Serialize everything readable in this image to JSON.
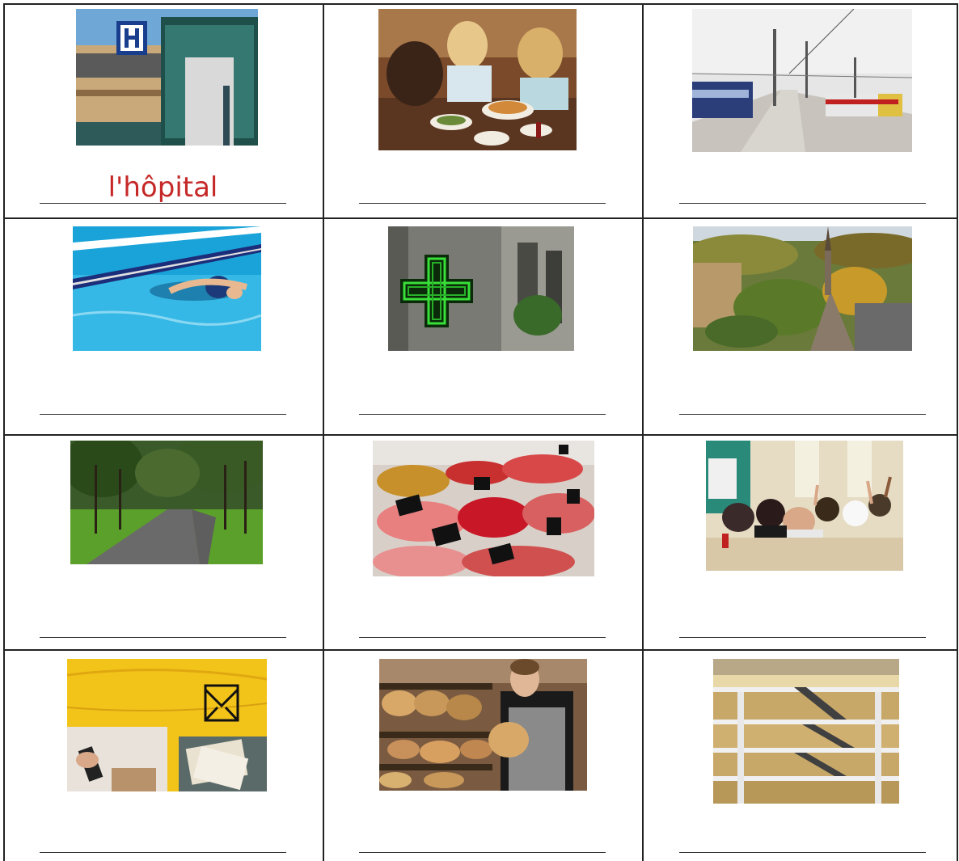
{
  "worksheet": {
    "cells": [
      {
        "picture": "hospital-building-photo",
        "answer": "l'hôpital"
      },
      {
        "picture": "restaurant-friends-dining-photo",
        "answer": ""
      },
      {
        "picture": "train-station-platform-photo",
        "answer": ""
      },
      {
        "picture": "swimming-pool-swimmer-photo",
        "answer": ""
      },
      {
        "picture": "pharmacy-green-cross-sign-photo",
        "answer": ""
      },
      {
        "picture": "town-valley-church-photo",
        "answer": ""
      },
      {
        "picture": "park-path-trees-photo",
        "answer": ""
      },
      {
        "picture": "butcher-meat-counter-photo",
        "answer": ""
      },
      {
        "picture": "classroom-students-photo",
        "answer": ""
      },
      {
        "picture": "post-office-yellow-van-photo",
        "answer": ""
      },
      {
        "picture": "bakery-baker-bread-photo",
        "answer": ""
      },
      {
        "picture": "shopping-mall-escalators-photo",
        "answer": ""
      }
    ]
  },
  "colors": {
    "answer_text": "#c62828",
    "grid_lines": "#222222"
  }
}
